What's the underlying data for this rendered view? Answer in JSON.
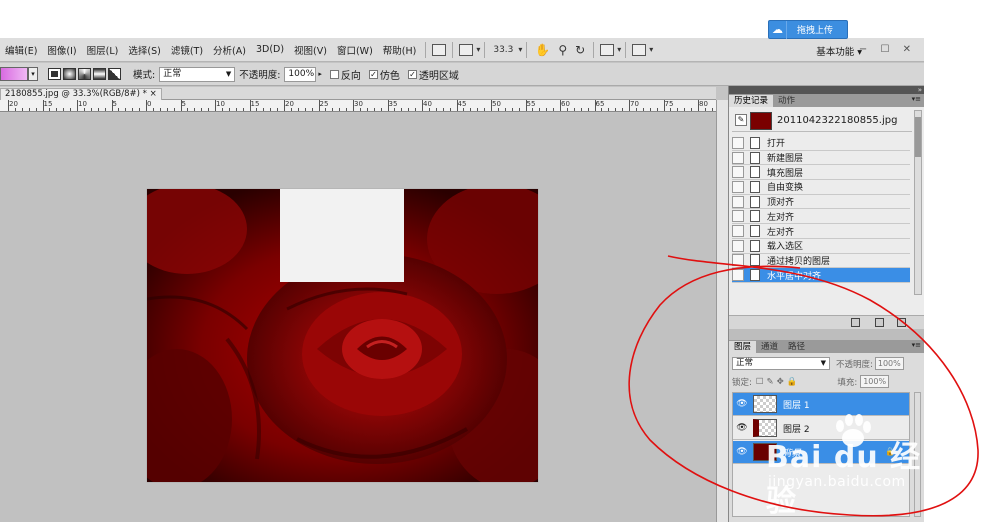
{
  "menubar": {
    "items": [
      "编辑(E)",
      "图像(I)",
      "图层(L)",
      "选择(S)",
      "滤镜(T)",
      "分析(A)",
      "3D(D)",
      "视图(V)",
      "窗口(W)",
      "帮助(H)"
    ],
    "zoom": "33.3",
    "workspace": "基本功能",
    "window_controls": "− ☐ ✕"
  },
  "options": {
    "mode_label": "模式:",
    "mode_value": "正常",
    "opacity_label": "不透明度:",
    "opacity_value": "100%",
    "reverse_label": "反向",
    "dither_label": "仿色",
    "transparency_label": "透明区域"
  },
  "upload_button": "拖拽上传",
  "document": {
    "tab_title": "2180855.jpg @ 33.3%(RGB/8#) *",
    "close": "×"
  },
  "ruler": {
    "labels": [
      "20",
      "15",
      "10",
      "5",
      "0",
      "5",
      "10",
      "15",
      "20",
      "25",
      "30",
      "35",
      "40",
      "45",
      "50",
      "55",
      "60",
      "65",
      "70",
      "75",
      "80"
    ]
  },
  "history_panel": {
    "tabs": [
      "历史记录",
      "动作"
    ],
    "snapshot_name": "2011042322180855.jpg",
    "steps": [
      "打开",
      "新建图层",
      "填充图层",
      "自由变换",
      "顶对齐",
      "左对齐",
      "左对齐",
      "载入选区",
      "通过拷贝的图层",
      "水平居中对齐"
    ],
    "selected_index": 9
  },
  "layers_panel": {
    "tabs": [
      "图层",
      "通道",
      "路径"
    ],
    "blend_mode": "正常",
    "opacity_label": "不透明度:",
    "opacity_value": "100%",
    "lock_label": "锁定:",
    "fill_label": "填充:",
    "fill_value": "100%",
    "layers": [
      {
        "name": "图层 1",
        "selected": true
      },
      {
        "name": "图层 2",
        "selected": false
      },
      {
        "name": "背景",
        "selected": true
      }
    ]
  },
  "watermark": {
    "brand": "Bai du 经验",
    "url": "jingyan.baidu.com"
  },
  "colors": {
    "selection_blue": "#3a8ee6",
    "annotation_red": "#e01010",
    "rose_dark": "#5a0000"
  }
}
